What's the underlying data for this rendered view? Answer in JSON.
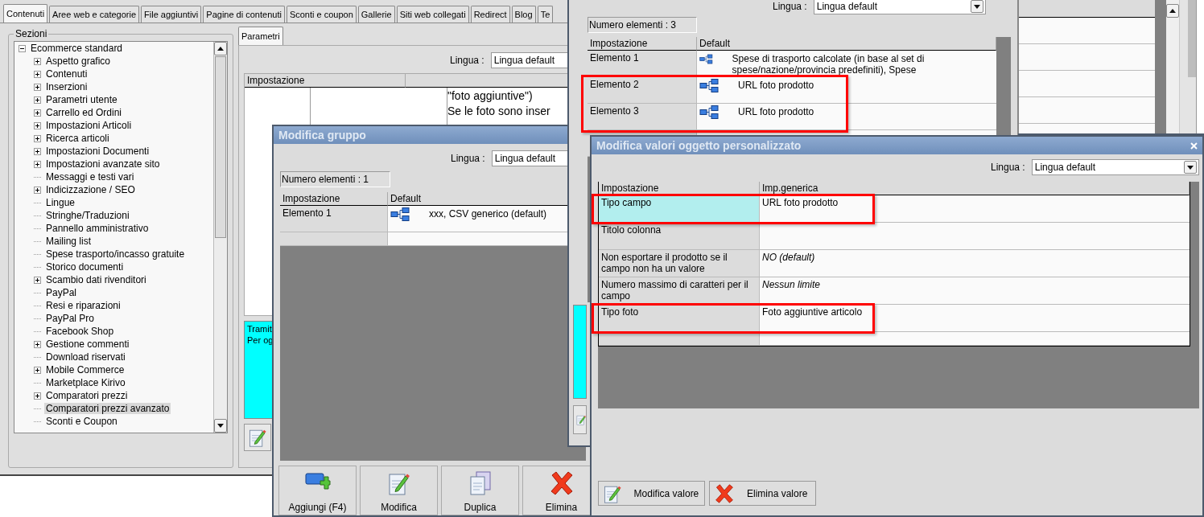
{
  "tabs": [
    {
      "label": "Contenuti",
      "selected": true
    },
    {
      "label": "Aree web e categorie",
      "selected": false
    },
    {
      "label": "File aggiuntivi",
      "selected": false
    },
    {
      "label": "Pagine di contenuti",
      "selected": false
    },
    {
      "label": "Sconti e coupon",
      "selected": false
    },
    {
      "label": "Gallerie",
      "selected": false
    },
    {
      "label": "Siti web collegati",
      "selected": false
    },
    {
      "label": "Redirect",
      "selected": false
    },
    {
      "label": "Blog",
      "selected": false
    },
    {
      "label": "Te",
      "selected": false
    }
  ],
  "sections": {
    "title": "Sezioni",
    "tree": [
      {
        "label": "Ecommerce standard",
        "expanded": true,
        "children": [
          {
            "label": "Aspetto grafico",
            "has_children": true,
            "selected": false
          },
          {
            "label": "Contenuti",
            "has_children": true,
            "selected": false
          },
          {
            "label": "Inserzioni",
            "has_children": true,
            "selected": false
          },
          {
            "label": "Parametri utente",
            "has_children": true,
            "selected": false
          },
          {
            "label": "Carrello ed Ordini",
            "has_children": true,
            "selected": false
          },
          {
            "label": "Impostazioni Articoli",
            "has_children": true,
            "selected": false
          },
          {
            "label": "Ricerca articoli",
            "has_children": true,
            "selected": false
          },
          {
            "label": "Impostazioni Documenti",
            "has_children": true,
            "selected": false
          },
          {
            "label": "Impostazioni avanzate sito",
            "has_children": true,
            "selected": false
          },
          {
            "label": "Messaggi e testi vari",
            "has_children": false,
            "selected": false
          },
          {
            "label": "Indicizzazione / SEO",
            "has_children": true,
            "selected": false
          },
          {
            "label": "Lingue",
            "has_children": false,
            "selected": false
          },
          {
            "label": "Stringhe/Traduzioni",
            "has_children": false,
            "selected": false
          },
          {
            "label": "Pannello amministrativo",
            "has_children": false,
            "selected": false
          },
          {
            "label": "Mailing list",
            "has_children": false,
            "selected": false
          },
          {
            "label": "Spese trasporto/incasso gratuite",
            "has_children": false,
            "selected": false
          },
          {
            "label": "Storico documenti",
            "has_children": false,
            "selected": false
          },
          {
            "label": "Scambio dati rivenditori",
            "has_children": true,
            "selected": false
          },
          {
            "label": "PayPal",
            "has_children": false,
            "selected": false
          },
          {
            "label": "Resi e riparazioni",
            "has_children": false,
            "selected": false
          },
          {
            "label": "PayPal Pro",
            "has_children": false,
            "selected": false
          },
          {
            "label": "Facebook Shop",
            "has_children": false,
            "selected": false
          },
          {
            "label": "Gestione commenti",
            "has_children": true,
            "selected": false
          },
          {
            "label": "Download riservati",
            "has_children": false,
            "selected": false
          },
          {
            "label": "Mobile Commerce",
            "has_children": true,
            "selected": false
          },
          {
            "label": "Marketplace Kirivo",
            "has_children": false,
            "selected": false
          },
          {
            "label": "Comparatori prezzi",
            "has_children": true,
            "selected": false
          },
          {
            "label": "Comparatori prezzi avanzato",
            "has_children": false,
            "selected": true
          },
          {
            "label": "Sconti e Coupon",
            "has_children": false,
            "selected": false
          }
        ]
      }
    ]
  },
  "parameters": {
    "tab": "Parametri",
    "language_label": "Lingua :",
    "language": "Lingua default",
    "column": "Impostazione",
    "description_lines": [
      "\"foto aggiuntive\")",
      "Se le foto sono inser"
    ],
    "info_lines": [
      "Tramit",
      "Per og"
    ]
  },
  "group_dialog": {
    "title": "Modifica gruppo",
    "language_label": "Lingua :",
    "language": "Lingua default",
    "count": "Numero elementi : 1",
    "columns": [
      "Impostazione",
      "Default"
    ],
    "rows": [
      {
        "setting": "Elemento 1",
        "value": "xxx, CSV generico (default)"
      }
    ],
    "buttons": [
      {
        "label": "Aggiungi (F4)",
        "kind": "add"
      },
      {
        "label": "Modifica",
        "kind": "edit"
      },
      {
        "label": "Duplica",
        "kind": "duplicate"
      },
      {
        "label": "Elimina",
        "kind": "delete"
      }
    ]
  },
  "elements_window": {
    "language_label": "Lingua :",
    "language": "Lingua default",
    "count": "Numero elementi : 3",
    "columns": [
      "Impostazione",
      "Default"
    ],
    "rows": [
      {
        "setting": "Elemento 1",
        "value": "Spese di trasporto calcolate (in base al set di spese/nazione/provincia predefiniti), Spese",
        "highlighted": false
      },
      {
        "setting": "Elemento 2",
        "value": "URL foto prodotto",
        "highlighted": true
      },
      {
        "setting": "Elemento 3",
        "value": "URL foto prodotto",
        "highlighted": true
      }
    ]
  },
  "values_dialog": {
    "title": "Modifica valori oggetto personalizzato",
    "language_label": "Lingua :",
    "language": "Lingua default",
    "columns": [
      "Impostazione",
      "Imp.generica"
    ],
    "rows": [
      {
        "setting": "Tipo campo",
        "value": "URL foto prodotto",
        "kind": "plain",
        "selected": true,
        "highlighted": true
      },
      {
        "setting": "Titolo colonna",
        "kind": "plain",
        "selected": false,
        "highlighted": false
      },
      {
        "setting": "Non esportare il prodotto se il campo non ha un valore",
        "value": "NO (default)",
        "kind": "default",
        "selected": false,
        "highlighted": false
      },
      {
        "setting": "Numero massimo di caratteri per il campo",
        "value": "Nessun limite",
        "kind": "default",
        "selected": false,
        "highlighted": false
      },
      {
        "setting": "Tipo foto",
        "value": "Foto aggiuntive articolo",
        "kind": "plain",
        "selected": false,
        "highlighted": true
      }
    ],
    "buttons": [
      {
        "label": "Modifica valore",
        "kind": "edit"
      },
      {
        "label": "Elimina valore",
        "kind": "delete"
      }
    ]
  }
}
